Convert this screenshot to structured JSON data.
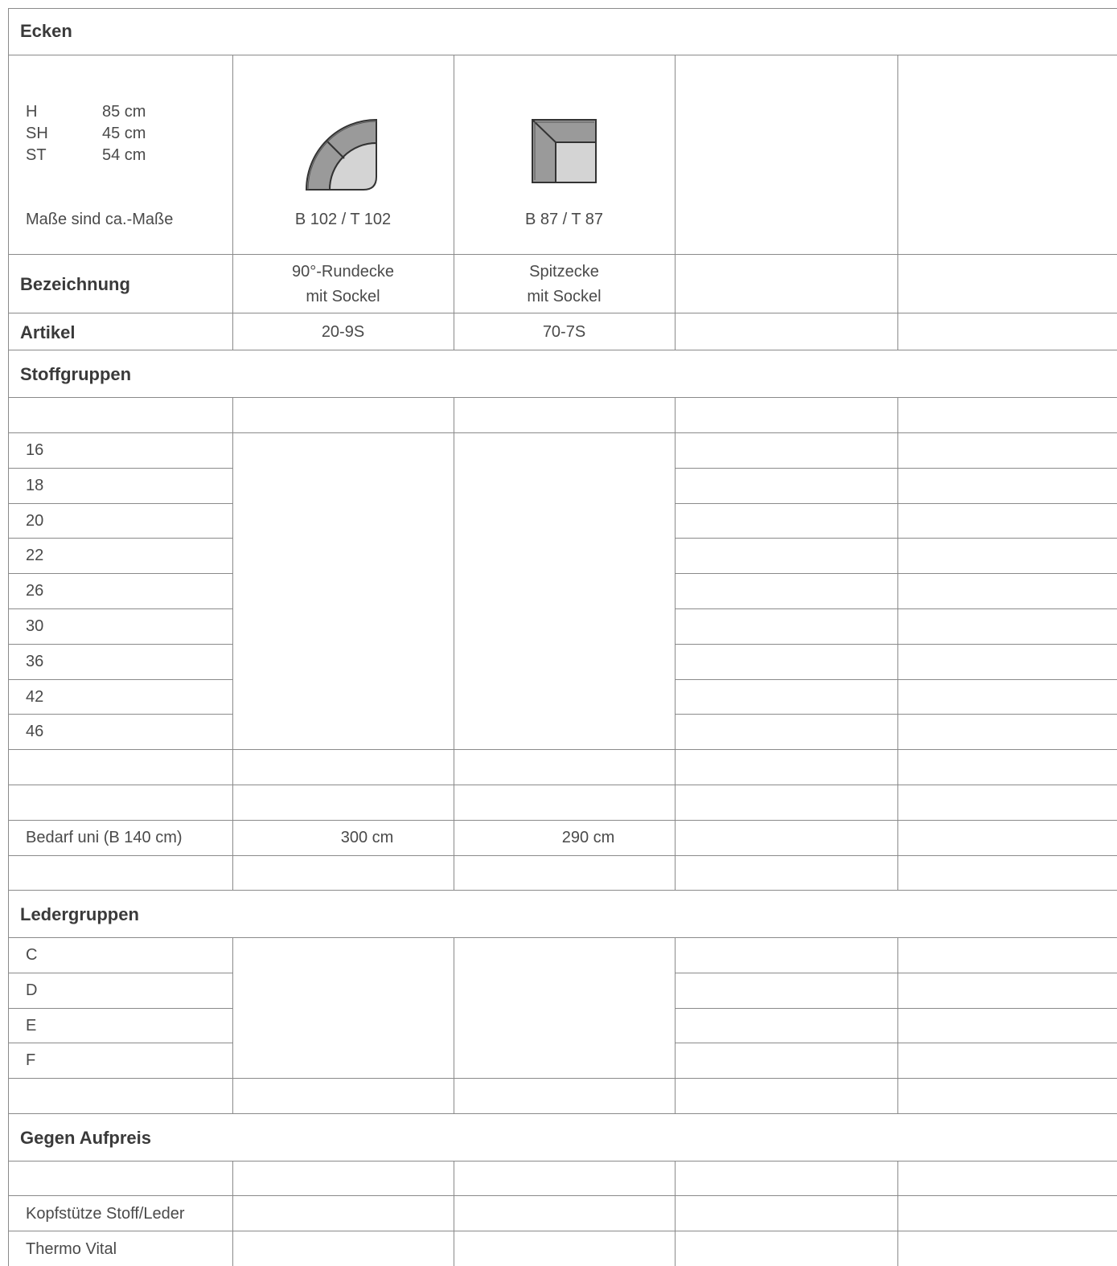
{
  "section_corners": "Ecken",
  "dimensions": [
    {
      "label": "H",
      "value": "85 cm"
    },
    {
      "label": "SH",
      "value": "45 cm"
    },
    {
      "label": "ST",
      "value": "54 cm"
    }
  ],
  "dimensions_note": "Maße sind ca.-Maße",
  "products": [
    {
      "size": "B 102 / T 102",
      "name_line1": "90°-Rundecke",
      "name_line2": "mit Sockel",
      "article": "20-9S",
      "fabric_need": "300 cm",
      "icon": "round-corner-sofa-icon"
    },
    {
      "size": "B 87 / T 87",
      "name_line1": "Spitzecke",
      "name_line2": "mit Sockel",
      "article": "70-7S",
      "fabric_need": "290 cm",
      "icon": "square-corner-sofa-icon"
    }
  ],
  "row_labels": {
    "designation": "Bezeichnung",
    "article": "Artikel",
    "fabric_need": "Bedarf uni (B 140 cm)"
  },
  "section_fabric": "Stoffgruppen",
  "fabric_groups": [
    "16",
    "18",
    "20",
    "22",
    "26",
    "30",
    "36",
    "42",
    "46"
  ],
  "section_leather": "Ledergruppen",
  "leather_groups": [
    "C",
    "D",
    "E",
    "F"
  ],
  "section_extras": "Gegen Aufpreis",
  "extras": [
    "Kopfstütze Stoff/Leder",
    "Thermo Vital"
  ],
  "colors": {
    "line": "#8a8a8a",
    "text": "#4a4a4a",
    "icon_dark": "#9a9a9a",
    "icon_light": "#d4d4d4"
  }
}
